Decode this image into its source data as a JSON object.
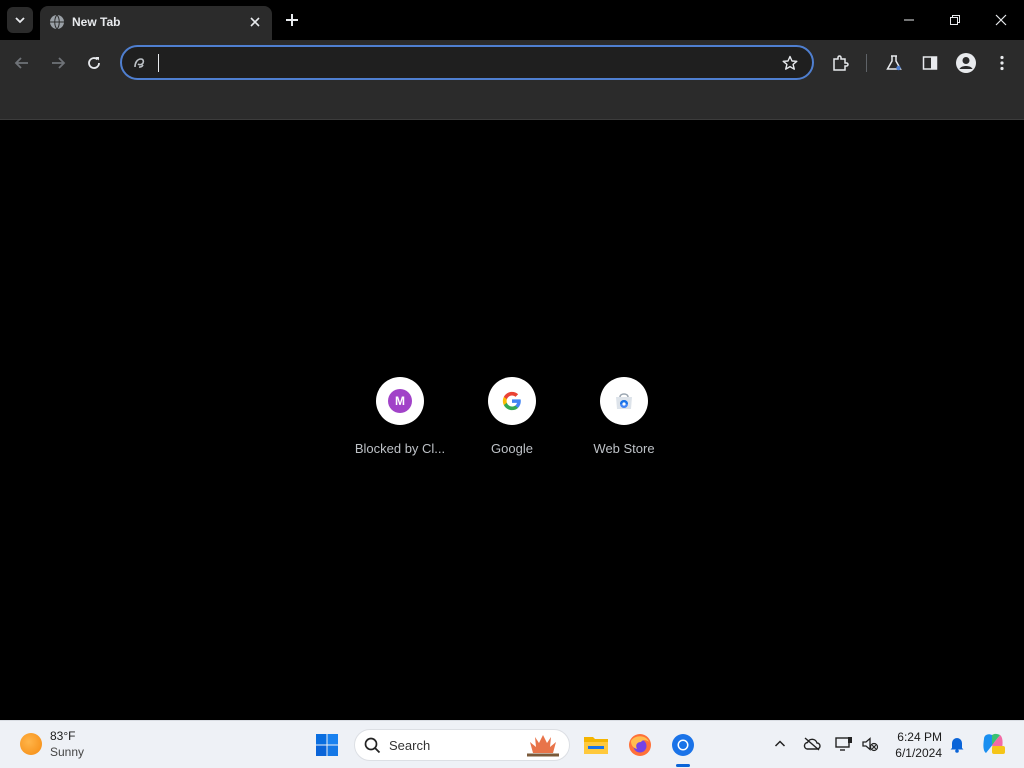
{
  "browser": {
    "tab": {
      "title": "New Tab"
    },
    "omnibox": {
      "value": "",
      "placeholder": ""
    }
  },
  "shortcuts": [
    {
      "label": "Blocked by Cl...",
      "badge": "M",
      "icon": "m-letter-icon"
    },
    {
      "label": "Google",
      "icon": "google-g-icon"
    },
    {
      "label": "Web Store",
      "icon": "web-store-icon"
    }
  ],
  "taskbar": {
    "weather": {
      "temp": "83°F",
      "condition": "Sunny"
    },
    "search": {
      "label": "Search"
    },
    "clock": {
      "time": "6:24 PM",
      "date": "6/1/2024"
    }
  },
  "colors": {
    "accent": "#4f7fd0",
    "toolbar": "#2b2b2b",
    "taskbar": "#eef1f6"
  }
}
